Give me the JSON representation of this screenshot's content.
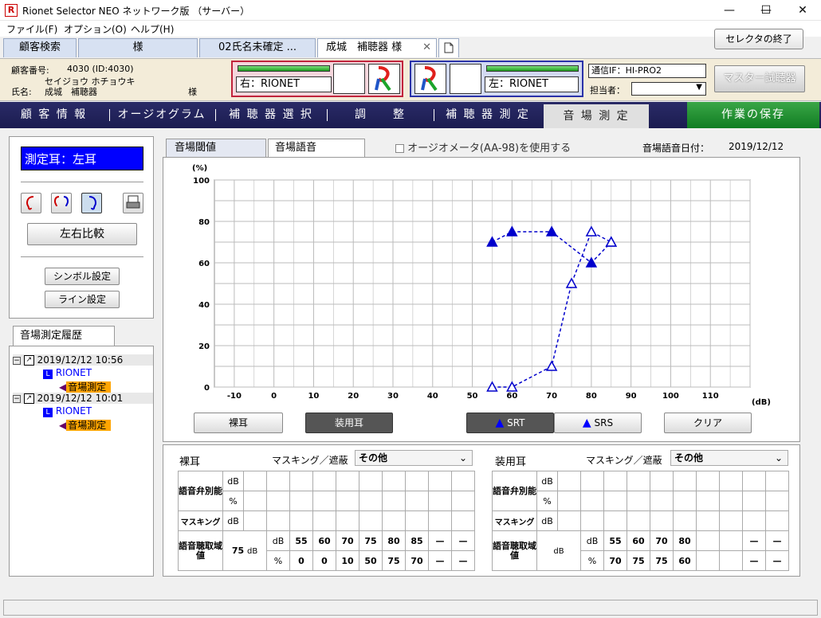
{
  "window": {
    "title": "Rionet Selector NEO ネットワーク版 （サーバー）",
    "minimize": "—",
    "maximize": "☐",
    "close": "✕"
  },
  "menu": [
    "ファイル(F)",
    "オプション(O)",
    "ヘルプ(H)"
  ],
  "tabs": [
    "顧客検索",
    "様",
    "02氏名未確定 ...",
    "成城　補聴器 様",
    "✕"
  ],
  "exit_button": "セレクタの終了",
  "customer": {
    "number_label": "顧客番号:",
    "number": "4030 (ID:4030)",
    "kana": "セイジョウ ホチョウキ",
    "name_label": "氏名:",
    "name": "成城　補聴器",
    "honorific": "様"
  },
  "ear_right": "右：RIONET",
  "ear_left": "左：RIONET",
  "comm": {
    "label": "通信IF：HI-PRO2",
    "staff_label": "担当者：",
    "staff_value": ""
  },
  "master_button": "マスター試聴器",
  "nav": [
    "顧 客 情 報",
    "オージオグラム",
    "補 聴 器 選 択",
    "調　　整",
    "補 聴 器 測 定",
    "音 場 測 定",
    "作業の保存"
  ],
  "left": {
    "measure_ear": "測定耳：左耳",
    "compare_button": "左右比較",
    "symbol_button": "シンボル設定",
    "line_button": "ライン設定"
  },
  "history": {
    "tab": "音場測定履歴",
    "entries": [
      {
        "date": "2019/12/12 10:56",
        "device": "RIONET",
        "item": "音場測定"
      },
      {
        "date": "2019/12/12 10:01",
        "device": "RIONET",
        "item": "音場測定"
      }
    ]
  },
  "graph_tabs": [
    "音場閾値",
    "音場語音"
  ],
  "audiometer_checkbox": "オージオメータ(AA-98)を使用する",
  "date_label": "音場語音日付：",
  "date_value": "2019/12/12",
  "chart_data": {
    "type": "line",
    "xlabel": "(dB)",
    "ylabel": "(%)",
    "xlim": [
      -15,
      120
    ],
    "ylim": [
      0,
      100
    ],
    "xticks": [
      "-10",
      "0",
      "10",
      "20",
      "30",
      "40",
      "50",
      "60",
      "70",
      "80",
      "90",
      "100",
      "110"
    ],
    "yticks": [
      "0",
      "20",
      "40",
      "60",
      "80",
      "100"
    ],
    "series": [
      {
        "name": "SRT",
        "marker": "filled-triangle",
        "color": "#0000cc",
        "x": [
          55,
          60,
          70,
          80,
          85
        ],
        "y": [
          70,
          75,
          75,
          60,
          70
        ]
      },
      {
        "name": "SRS",
        "marker": "open-triangle",
        "color": "#0000cc",
        "x": [
          55,
          60,
          70,
          75,
          80,
          85
        ],
        "y": [
          0,
          0,
          10,
          50,
          75,
          70
        ]
      }
    ],
    "grid": true
  },
  "graph_buttons": {
    "bare": "裸耳",
    "aided": "装用耳",
    "srt": "SRT",
    "srs": "SRS",
    "clear": "クリア"
  },
  "bare_ear": {
    "title": "裸耳",
    "masking_label": "マスキング／遮蔽",
    "masking_value": "その他",
    "rows": {
      "discrimination": "語音弁別能",
      "masking": "マスキング",
      "threshold": "語音聴取域値"
    },
    "units": {
      "db": "dB",
      "pct": "%"
    },
    "threshold_value": "75",
    "db_values": [
      "55",
      "60",
      "70",
      "75",
      "80",
      "85",
      "—",
      "—"
    ],
    "pct_values": [
      "0",
      "0",
      "10",
      "50",
      "75",
      "70",
      "—",
      "—"
    ]
  },
  "aided_ear": {
    "title": "装用耳",
    "masking_label": "マスキング／遮蔽",
    "masking_value": "その他",
    "rows": {
      "discrimination": "語音弁別能",
      "masking": "マスキング",
      "threshold": "語音聴取域値"
    },
    "units": {
      "db": "dB",
      "pct": "%"
    },
    "threshold_value": "",
    "db_values": [
      "55",
      "60",
      "70",
      "80",
      "",
      "",
      "—",
      "—"
    ],
    "pct_values": [
      "70",
      "75",
      "75",
      "60",
      "",
      "",
      "—",
      "—"
    ]
  },
  "colors": {
    "nav_bg": "#1b1c50",
    "save_bg": "#1a8a2c",
    "srt": "#0000cc",
    "history_highlight": "#ffa500"
  }
}
